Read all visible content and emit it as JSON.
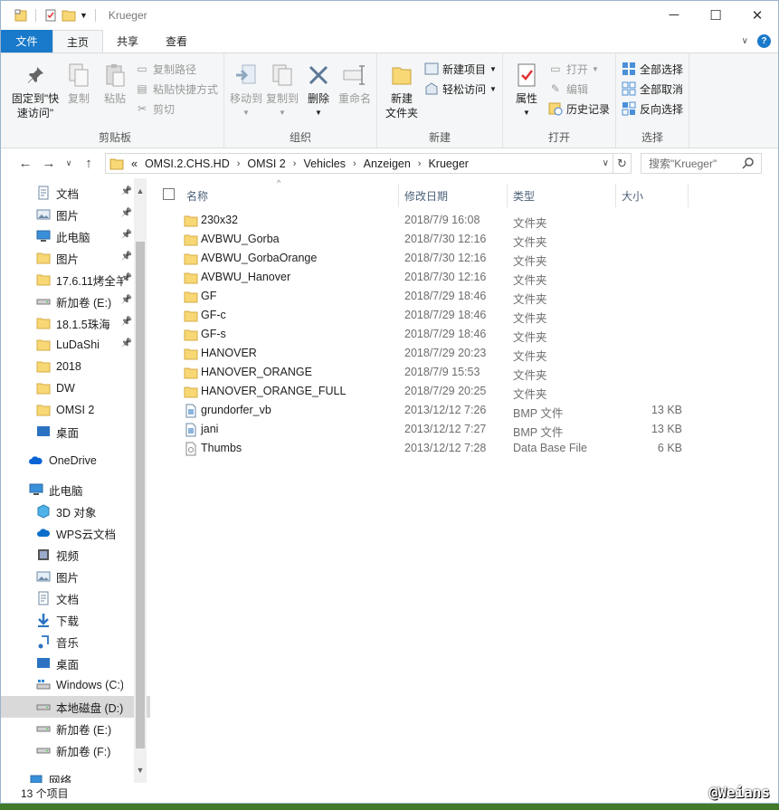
{
  "window": {
    "title": "Krueger"
  },
  "ribbon_tabs": [
    "文件",
    "主页",
    "共享",
    "查看"
  ],
  "ribbon": {
    "clipboard": {
      "label": "剪贴板",
      "pin": "固定到\"快速访问\"",
      "copy": "复制",
      "paste": "粘贴",
      "copy_path": "复制路径",
      "paste_shortcut": "粘贴快捷方式",
      "cut": "剪切"
    },
    "organize": {
      "label": "组织",
      "move_to": "移动到",
      "copy_to": "复制到",
      "delete": "删除",
      "rename": "重命名"
    },
    "new": {
      "label": "新建",
      "new_folder": "新建\n文件夹",
      "new_item": "新建项目",
      "easy_access": "轻松访问"
    },
    "open": {
      "label": "打开",
      "properties": "属性",
      "open": "打开",
      "edit": "编辑",
      "history": "历史记录"
    },
    "select": {
      "label": "选择",
      "select_all": "全部选择",
      "select_none": "全部取消",
      "invert": "反向选择"
    }
  },
  "address": {
    "overflow": "«",
    "crumbs": [
      "OMSI.2.CHS.HD",
      "OMSI 2",
      "Vehicles",
      "Anzeigen",
      "Krueger"
    ],
    "search_placeholder": "搜索\"Krueger\""
  },
  "nav": {
    "quick_access": [
      {
        "label": "文档",
        "icon": "documents-icon"
      },
      {
        "label": "图片",
        "icon": "pictures-icon"
      },
      {
        "label": "此电脑",
        "icon": "computer-icon"
      },
      {
        "label": "图片",
        "icon": "folder-icon"
      },
      {
        "label": "17.6.11烤全羊",
        "icon": "folder-icon"
      },
      {
        "label": "新加卷 (E:)",
        "icon": "drive-icon"
      },
      {
        "label": "18.1.5珠海",
        "icon": "folder-icon"
      },
      {
        "label": "LuDaShi",
        "icon": "folder-icon"
      },
      {
        "label": "2018",
        "icon": "folder-icon"
      },
      {
        "label": "DW",
        "icon": "folder-icon"
      },
      {
        "label": "OMSI 2",
        "icon": "folder-icon"
      },
      {
        "label": "桌面",
        "icon": "desktop-icon"
      }
    ],
    "onedrive": "OneDrive",
    "this_pc": "此电脑",
    "pc_items": [
      {
        "label": "3D 对象",
        "icon": "3d-objects-icon"
      },
      {
        "label": "WPS云文档",
        "icon": "cloud-icon"
      },
      {
        "label": "视频",
        "icon": "video-icon"
      },
      {
        "label": "图片",
        "icon": "pictures-icon"
      },
      {
        "label": "文档",
        "icon": "documents-icon"
      },
      {
        "label": "下载",
        "icon": "download-icon"
      },
      {
        "label": "音乐",
        "icon": "music-icon"
      },
      {
        "label": "桌面",
        "icon": "desktop-icon"
      },
      {
        "label": "Windows (C:)",
        "icon": "windows-drive-icon"
      },
      {
        "label": "本地磁盘 (D:)",
        "icon": "drive-icon"
      },
      {
        "label": "新加卷 (E:)",
        "icon": "drive-icon"
      },
      {
        "label": "新加卷 (F:)",
        "icon": "drive-icon"
      }
    ],
    "network": "网络"
  },
  "columns": {
    "name": "名称",
    "date": "修改日期",
    "type": "类型",
    "size": "大小"
  },
  "files": [
    {
      "name": "230x32",
      "date": "2018/7/9 16:08",
      "type": "文件夹",
      "size": "",
      "icon": "folder-icon"
    },
    {
      "name": "AVBWU_Gorba",
      "date": "2018/7/30 12:16",
      "type": "文件夹",
      "size": "",
      "icon": "folder-icon"
    },
    {
      "name": "AVBWU_GorbaOrange",
      "date": "2018/7/30 12:16",
      "type": "文件夹",
      "size": "",
      "icon": "folder-icon"
    },
    {
      "name": "AVBWU_Hanover",
      "date": "2018/7/30 12:16",
      "type": "文件夹",
      "size": "",
      "icon": "folder-icon"
    },
    {
      "name": "GF",
      "date": "2018/7/29 18:46",
      "type": "文件夹",
      "size": "",
      "icon": "folder-icon"
    },
    {
      "name": "GF-c",
      "date": "2018/7/29 18:46",
      "type": "文件夹",
      "size": "",
      "icon": "folder-icon"
    },
    {
      "name": "GF-s",
      "date": "2018/7/29 18:46",
      "type": "文件夹",
      "size": "",
      "icon": "folder-icon"
    },
    {
      "name": "HANOVER",
      "date": "2018/7/29 20:23",
      "type": "文件夹",
      "size": "",
      "icon": "folder-icon"
    },
    {
      "name": "HANOVER_ORANGE",
      "date": "2018/7/9 15:53",
      "type": "文件夹",
      "size": "",
      "icon": "folder-icon"
    },
    {
      "name": "HANOVER_ORANGE_FULL",
      "date": "2018/7/29 20:25",
      "type": "文件夹",
      "size": "",
      "icon": "folder-icon"
    },
    {
      "name": "grundorfer_vb",
      "date": "2013/12/12 7:26",
      "type": "BMP 文件",
      "size": "13 KB",
      "icon": "bmp-file-icon"
    },
    {
      "name": "jani",
      "date": "2013/12/12 7:27",
      "type": "BMP 文件",
      "size": "13 KB",
      "icon": "bmp-file-icon"
    },
    {
      "name": "Thumbs",
      "date": "2013/12/12 7:28",
      "type": "Data Base File",
      "size": "6 KB",
      "icon": "db-file-icon"
    }
  ],
  "status": {
    "count": "13 个项目"
  },
  "watermark": "@Weians",
  "colors": {
    "accent": "#1979ca",
    "folder": "#f8d775",
    "selection": "#d9d9d9"
  }
}
